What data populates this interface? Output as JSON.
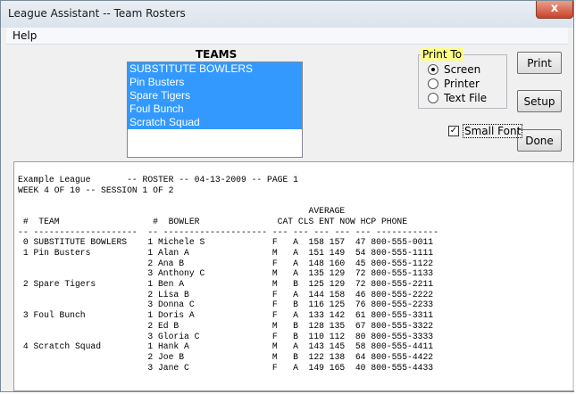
{
  "window": {
    "title": "League Assistant -- Team Rosters",
    "close": "x"
  },
  "menu": {
    "help": "Help"
  },
  "teams": {
    "label": "TEAMS",
    "items": [
      "SUBSTITUTE BOWLERS",
      "Pin Busters",
      "Spare Tigers",
      "Foul Bunch",
      "Scratch Squad"
    ]
  },
  "print_to": {
    "legend": "Print To",
    "options": [
      "Screen",
      "Printer",
      "Text File"
    ],
    "selected": "Screen"
  },
  "buttons": {
    "print": "Print",
    "setup": "Setup",
    "done": "Done"
  },
  "small_font": {
    "label": "Small Font",
    "checked": true,
    "mark": "✓"
  },
  "report": {
    "header1": "Example League       -- ROSTER -- 04-13-2009 -- PAGE 1",
    "header2": "WEEK 4 OF 10 -- SESSION 1 OF 2",
    "col_hdr1": "                                                        AVERAGE",
    "col_hdr2": " #  TEAM                  #  BOWLER               CAT CLS ENT NOW HCP PHONE",
    "rule": "-- --------------------  -- -------------------- --- --- --- --- --- ------------",
    "rows": [
      " 0 SUBSTITUTE BOWLERS    1 Michele S             F   A  158 157  47 800-555-0011",
      " 1 Pin Busters           1 Alan A                M   A  151 149  54 800-555-1111",
      "                         2 Ana B                 F   A  148 160  45 800-555-1122",
      "                         3 Anthony C             M   A  135 129  72 800-555-1133",
      " 2 Spare Tigers          1 Ben A                 M   B  125 129  72 800-555-2211",
      "                         2 Lisa B                F   A  144 158  46 800-555-2222",
      "                         3 Donna C               F   B  116 125  76 800-555-2233",
      " 3 Foul Bunch            1 Doris A               F   A  133 142  61 800-555-3311",
      "                         2 Ed B                  M   B  128 135  67 800-555-3322",
      "                         3 Gloria C              F   B  110 112  80 800-555-3333",
      " 4 Scratch Squad         1 Hank A                M   A  143 145  58 800-555-4411",
      "                         2 Joe B                 M   B  122 138  64 800-555-4422",
      "                         3 Jane C                F   A  149 165  40 800-555-4433"
    ]
  }
}
